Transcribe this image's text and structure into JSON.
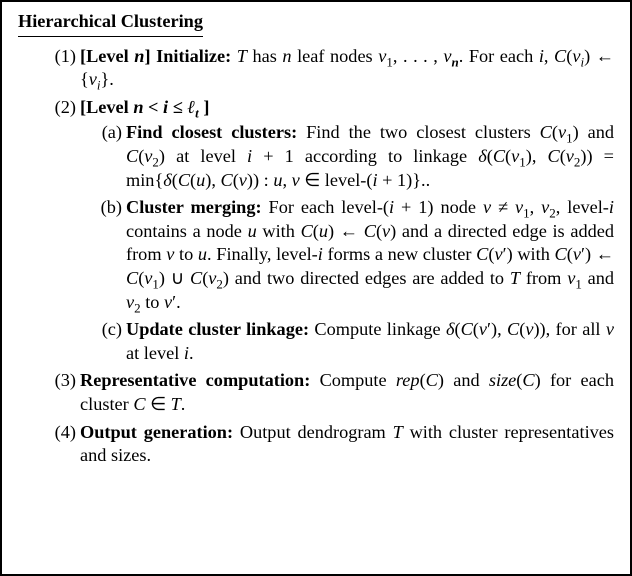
{
  "title": "Hierarchical Clustering",
  "steps": [
    {
      "num": "(1)",
      "label_html": "<span class='b'>[Level <span class='bi'>n</span>] Initialize:</span> ",
      "body_html": "<span class='i'>T</span> has <span class='i'>n</span> leaf nodes <span class='i'>v</span><sub>1</sub>, . . . , <span class='i'>v</span><sub><span class='bi'>n</span></sub>. For each <span class='i'>i</span>, <span class='i'>C</span>(<span class='i'>v<sub>i</sub></span>) ← {<span class='i'>v<sub>i</sub></span>}."
    },
    {
      "num": "(2)",
      "label_html": "<span class='b'>[Level <span class='bi'>n</span> &lt; <span class='bi'>i</span> ≤ <span class='bi'>ℓ<sub>t</sub></span> ]</span>",
      "body_html": "",
      "sub": [
        {
          "sn": "(a)",
          "label_html": "<span class='b'>Find closest clusters:</span> ",
          "body_html": "Find the two closest clusters <span class='i'>C</span>(<span class='i'>v</span><sub>1</sub>) and <span class='i'>C</span>(<span class='i'>v</span><sub>2</sub>) at level <span class='i'>i</span> + 1 according to linkage <span class='i'>δ</span>(<span class='i'>C</span>(<span class='i'>v</span><sub>1</sub>), <span class='i'>C</span>(<span class='i'>v</span><sub>2</sub>)) = min{<span class='i'>δ</span>(<span class='i'>C</span>(<span class='i'>u</span>), <span class='i'>C</span>(<span class='i'>v</span>)) : <span class='i'>u</span>, <span class='i'>v</span> ∈ level-(<span class='i'>i</span> + 1)}.."
        },
        {
          "sn": "(b)",
          "label_html": "<span class='b'>Cluster merging:</span> ",
          "body_html": "For each level-(<span class='i'>i</span> + 1) node <span class='i'>v</span> ≠ <span class='i'>v</span><sub>1</sub>, <span class='i'>v</span><sub>2</sub>, level-<span class='i'>i</span> contains a node <span class='i'>u</span> with <span class='i'>C</span>(<span class='i'>u</span>) ← <span class='i'>C</span>(<span class='i'>v</span>) and a directed edge is added from <span class='i'>v</span> to <span class='i'>u</span>. Finally, level-<span class='i'>i</span> forms a new cluster <span class='i'>C</span>(<span class='i'>v</span>′) with <span class='i'>C</span>(<span class='i'>v</span>′) ← <span class='i'>C</span>(<span class='i'>v</span><sub>1</sub>) ∪ <span class='i'>C</span>(<span class='i'>v</span><sub>2</sub>) and two directed edges are added to <span class='i'>T</span> from <span class='i'>v</span><sub>1</sub> and <span class='i'>v</span><sub>2</sub> to <span class='i'>v</span>′."
        },
        {
          "sn": "(c)",
          "label_html": "<span class='b'>Update cluster linkage:</span> ",
          "body_html": " Compute linkage <span class='i'>δ</span>(<span class='i'>C</span>(<span class='i'>v</span>′), <span class='i'>C</span>(<span class='i'>v</span>)), for all <span class='i'>v</span> at level <span class='i'>i</span>."
        }
      ]
    },
    {
      "num": "(3)",
      "label_html": "<span class='b'>Representative computation:</span> ",
      "body_html": " Compute <span class='i'>rep</span>(<span class='i'>C</span>) and <span class='i'>size</span>(<span class='i'>C</span>) for each cluster <span class='i'>C</span> ∈ <span class='i'>T</span>."
    },
    {
      "num": "(4)",
      "label_html": "<span class='b'>Output generation:</span> ",
      "body_html": "Output dendrogram <span class='i'>T</span> with cluster representatives and sizes."
    }
  ]
}
